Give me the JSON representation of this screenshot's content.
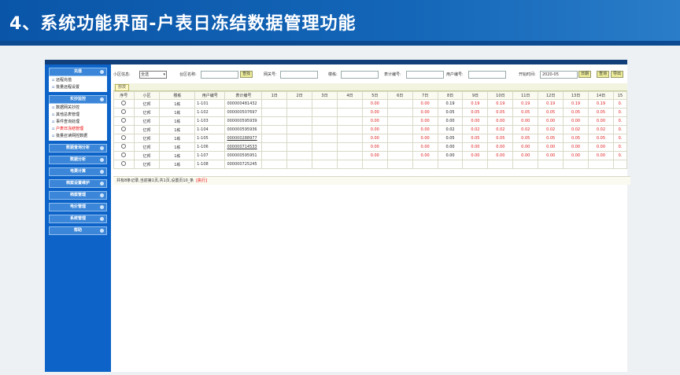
{
  "slide": {
    "title": "4、系统功能界面-户表日冻结数据管理功能"
  },
  "sidebar": {
    "groups": [
      {
        "label": "充值",
        "items": [
          {
            "label": "远程充值"
          },
          {
            "label": "批量远程设置"
          }
        ]
      },
      {
        "label": "实抄监控",
        "items": [
          {
            "label": "数据网关抄控"
          },
          {
            "label": "其他总表管理"
          },
          {
            "label": "事件查询处理"
          },
          {
            "label": "户表日冻结管理",
            "active": true
          },
          {
            "label": "批量召读网控数据"
          }
        ]
      },
      {
        "label": "数据查询分析",
        "items": []
      },
      {
        "label": "数据分析",
        "items": []
      },
      {
        "label": "电费计算",
        "items": []
      },
      {
        "label": "档案设置维护",
        "items": []
      },
      {
        "label": "档案管理",
        "items": []
      },
      {
        "label": "电价管理",
        "items": []
      },
      {
        "label": "系统管理",
        "items": []
      },
      {
        "label": "帮助",
        "items": []
      }
    ]
  },
  "filter": {
    "community_label": "小区信息:",
    "community_value": "全选",
    "unit_label": "台区名称:",
    "search_label": "查找",
    "gateway_label": "网关号:",
    "building_label": "楼栋:",
    "meter_label": "表计编号:",
    "user_label": "用户编号:",
    "start_label": "开始时间:",
    "start_value": "2020-05",
    "date_btn": "日期",
    "query_btn": "查询",
    "export_btn": "导出"
  },
  "step_tag": "抄次",
  "table": {
    "headers": [
      "序号",
      "小区",
      "楼栋",
      "用户编号",
      "表计编号",
      "1日",
      "2日",
      "3日",
      "4日",
      "5日",
      "6日",
      "7日",
      "8日",
      "9日",
      "10日",
      "11日",
      "12日",
      "13日",
      "14日",
      "15"
    ],
    "rows": [
      {
        "community": "亿邦",
        "building": "1栋",
        "user": "1-101",
        "meter": "000000481432",
        "meter_link": false,
        "d5": "0.00",
        "d7": "0.00",
        "d8": "0.19",
        "d9": "0.19",
        "d10": "0.19",
        "d11": "0.19",
        "d12": "0.19",
        "d13": "0.19",
        "d14": "0.19",
        "d15": "0."
      },
      {
        "community": "亿邦",
        "building": "1栋",
        "user": "1-102",
        "meter": "000000507697",
        "meter_link": false,
        "d5": "0.00",
        "d7": "0.00",
        "d8": "0.05",
        "d9": "0.05",
        "d10": "0.05",
        "d11": "0.05",
        "d12": "0.05",
        "d13": "0.05",
        "d14": "0.05",
        "d15": "0."
      },
      {
        "community": "亿邦",
        "building": "1栋",
        "user": "1-103",
        "meter": "000000595939",
        "meter_link": false,
        "d5": "0.00",
        "d7": "0.00",
        "d8": "0.00",
        "d9": "0.00",
        "d10": "0.00",
        "d11": "0.00",
        "d12": "0.00",
        "d13": "0.00",
        "d14": "0.00",
        "d15": "0."
      },
      {
        "community": "亿邦",
        "building": "1栋",
        "user": "1-104",
        "meter": "000000595936",
        "meter_link": false,
        "d5": "0.00",
        "d7": "0.00",
        "d8": "0.02",
        "d9": "0.02",
        "d10": "0.02",
        "d11": "0.02",
        "d12": "0.02",
        "d13": "0.02",
        "d14": "0.02",
        "d15": "0."
      },
      {
        "community": "亿邦",
        "building": "1栋",
        "user": "1-105",
        "meter": "000000288977",
        "meter_link": true,
        "d5": "0.00",
        "d7": "0.00",
        "d8": "0.05",
        "d9": "0.05",
        "d10": "0.05",
        "d11": "0.05",
        "d12": "0.05",
        "d13": "0.05",
        "d14": "0.05",
        "d15": "0."
      },
      {
        "community": "亿邦",
        "building": "1栋",
        "user": "1-106",
        "meter": "000000714533",
        "meter_link": true,
        "d5": "0.00",
        "d7": "0.00",
        "d8": "0.00",
        "d9": "0.00",
        "d10": "0.00",
        "d11": "0.00",
        "d12": "0.00",
        "d13": "0.00",
        "d14": "0.00",
        "d15": "0."
      },
      {
        "community": "亿邦",
        "building": "1栋",
        "user": "1-107",
        "meter": "000000595951",
        "meter_link": false,
        "d5": "0.00",
        "d7": "0.00",
        "d8": "0.00",
        "d9": "0.00",
        "d10": "0.00",
        "d11": "0.00",
        "d12": "0.00",
        "d13": "0.00",
        "d14": "0.00",
        "d15": "0."
      },
      {
        "community": "亿邦",
        "building": "1栋",
        "user": "1-108",
        "meter": "000000725245",
        "meter_link": false,
        "d5": "",
        "d7": "",
        "d8": "",
        "d9": "",
        "d10": "",
        "d11": "",
        "d12": "",
        "d13": "",
        "d14": "",
        "d15": ""
      }
    ]
  },
  "pager": {
    "text": "共有8条记录,当前第1页,共1页,设置页10_条",
    "exec": "[执行]"
  }
}
